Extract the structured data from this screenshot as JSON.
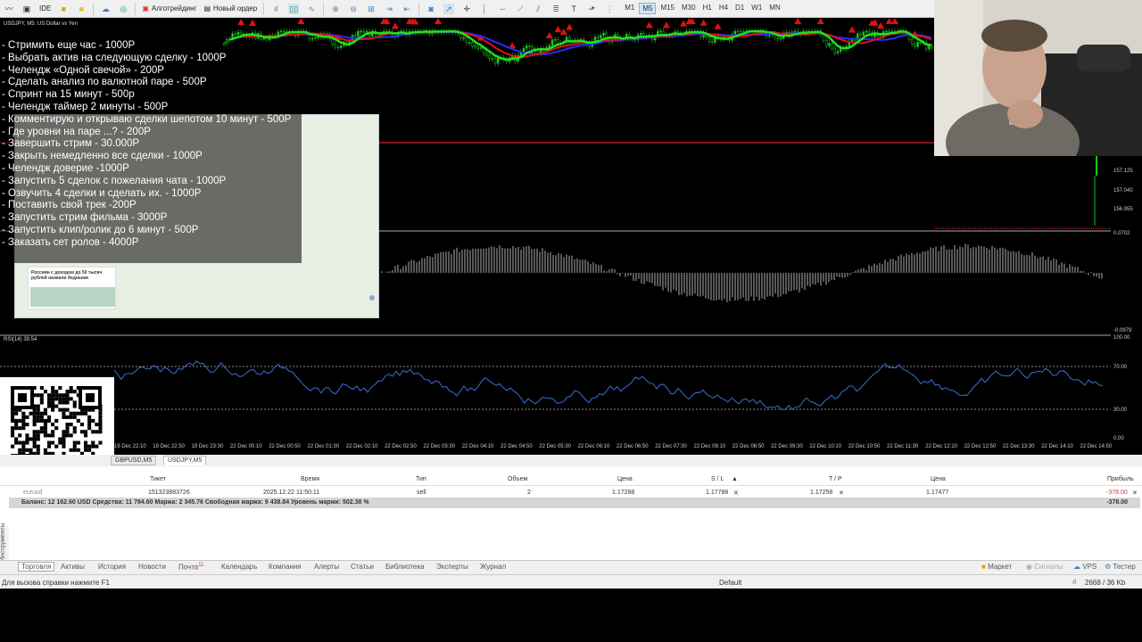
{
  "toolbar": {
    "algo_label": "Алготрейдинг",
    "new_order_label": "Новый ордер",
    "ide_label": "IDE",
    "timeframes": [
      "M1",
      "M5",
      "M15",
      "M30",
      "H1",
      "H4",
      "D1",
      "W1",
      "MN"
    ],
    "active_timeframe": "M5"
  },
  "chart": {
    "symbol_label": "USDJPY, M5:  US Dollar vs Yen",
    "rsi_label": "RSI(14) 39.54",
    "price_ticks": [
      "157.125",
      "157.040",
      "156.955"
    ],
    "macd_ticks": [
      "0.0702",
      "-0.0979"
    ],
    "rsi_ticks": [
      "100.00",
      "70.00",
      "30.00",
      "0.00"
    ],
    "time_labels": [
      "19 Dec 22:10",
      "19 Dec 22:50",
      "19 Dec 23:30",
      "22 Dec 00:10",
      "22 Dec 00:50",
      "22 Dec 01:30",
      "22 Dec 02:10",
      "22 Dec 02:50",
      "22 Dec 03:30",
      "22 Dec 04:10",
      "22 Dec 04:50",
      "22 Dec 05:30",
      "22 Dec 06:10",
      "22 Dec 06:50",
      "22 Dec 07:30",
      "22 Dec 08:10",
      "22 Dec 08:50",
      "22 Dec 09:30",
      "22 Dec 10:10",
      "22 Dec 10:50",
      "22 Dec 11:30",
      "22 Dec 12:10",
      "22 Dec 12:50",
      "22 Dec 13:30",
      "22 Dec 14:10",
      "22 Dec 14:50"
    ]
  },
  "overlay": {
    "items": [
      "- Стримить еще час - 1000Р",
      "- Выбрать актив на следующую сделку - 1000Р",
      "- Челендж «Одной свечой» - 200Р",
      "- Сделать анализ по валютной паре - 500Р",
      "- Спринт на 15 минут - 500р",
      "- Челендж таймер 2 минуты - 500Р",
      "- Комментирую и открываю сделки шепотом 10 минут - 500Р",
      "- Где уровни на паре ...?  - 200Р",
      "- Завершить стрим - 30.000Р",
      "- Закрыть немедленно все сделки - 1000Р",
      "- Челендж доверие -1000Р",
      "- Запустить 5 сделок с пожелания чата - 1000Р",
      "- Озвучить 4 сделки и сделать их. - 1000Р",
      "- Поставить свой трек -200Р",
      "- Запустить стрим фильма - 3000Р",
      "- Запустить клип/ролик до 6 минут - 500Р",
      "- Заказать сет ролов - 4000Р"
    ]
  },
  "ad": {
    "headline": "Россиян с доходом до 50 тысяч рублей назвали бедными"
  },
  "chart_tabs": [
    "GBPUSD,M5",
    "USDJPY,M5"
  ],
  "terminal": {
    "headers": {
      "ticket": "Тикет",
      "time": "Время",
      "type": "Тип",
      "volume": "Объем",
      "price": "Цена",
      "sl": "S / L",
      "tp": "T / P",
      "price2": "Цена",
      "profit": "Прибыль"
    },
    "row": {
      "symbol": "eurusd",
      "ticket": "151323883726",
      "time": "2025.12.22 11:50:11",
      "type": "sell",
      "volume": "2",
      "price": "1.17288",
      "sl": "1.17788",
      "tp": "1.17258",
      "price2": "1.17477",
      "profit": "-378.00"
    },
    "balance": "Баланс: 12 162.60 USD  Средства: 11 784.60  Маржа: 2 345.76  Свободная маржа: 9 438.84  Уровень маржи: 502.38 %",
    "total_profit": "-378.00"
  },
  "bottom_tabs": [
    "Торговля",
    "Активы",
    "История",
    "Новости",
    "Почта",
    "Календарь",
    "Компания",
    "Алерты",
    "Статьи",
    "Библиотека",
    "Эксперты",
    "Журнал"
  ],
  "mail_badge": "11",
  "bottom_right": {
    "market": "Маркет",
    "signals": "Сигналы",
    "vps": "VPS",
    "tester": "Тестер"
  },
  "sidebar_label": "Инструменты",
  "status": {
    "help": "Для вызова справки нажмите F1",
    "profile": "Default",
    "traffic": "2668 / 36 Kb"
  }
}
